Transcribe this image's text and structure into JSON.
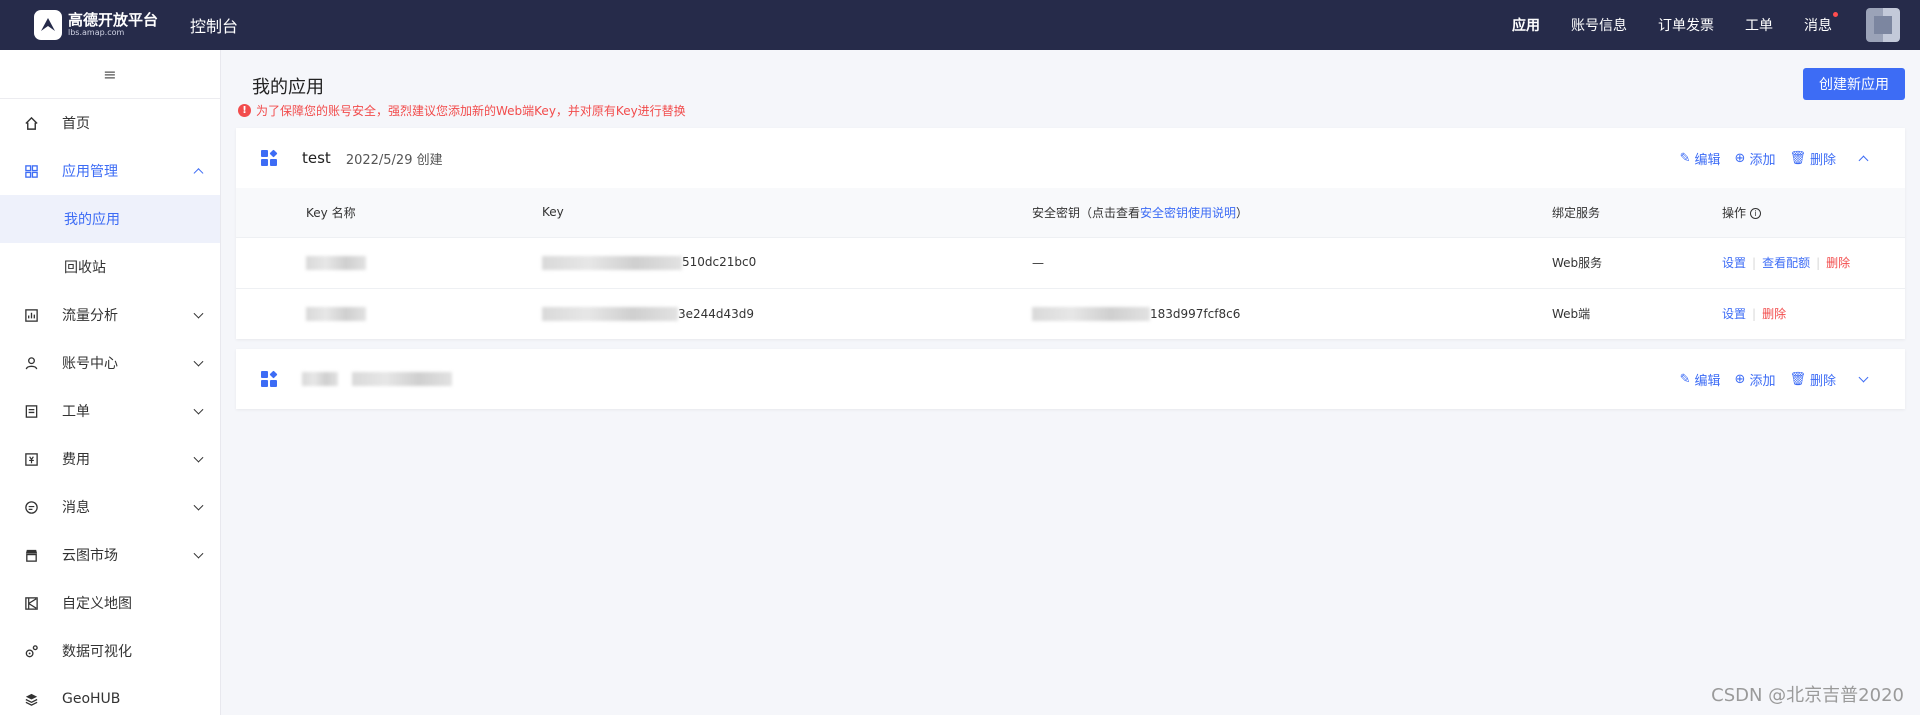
{
  "header": {
    "logo_cn": "高德开放平台",
    "logo_en": "lbs.amap.com",
    "console": "控制台",
    "nav": [
      "应用",
      "账号信息",
      "订单发票",
      "工单",
      "消息"
    ]
  },
  "sidebar": {
    "toggle": "≡",
    "items": [
      {
        "label": "首页"
      },
      {
        "label": "应用管理",
        "sub": [
          "我的应用",
          "回收站"
        ]
      },
      {
        "label": "流量分析"
      },
      {
        "label": "账号中心"
      },
      {
        "label": "工单"
      },
      {
        "label": "费用"
      },
      {
        "label": "消息"
      },
      {
        "label": "云图市场"
      },
      {
        "label": "自定义地图"
      },
      {
        "label": "数据可视化"
      },
      {
        "label": "GeoHUB"
      }
    ]
  },
  "main": {
    "title": "我的应用",
    "warning": "为了保障您的账号安全，强烈建议您添加新的Web端Key，并对原有Key进行替换",
    "create_button": "创建新应用",
    "actions": {
      "edit": "编辑",
      "add": "添加",
      "delete": "删除"
    },
    "apps": [
      {
        "name": "test",
        "date": "2022/5/29 创建",
        "columns": {
          "key_name": "Key 名称",
          "key": "Key",
          "secret_prefix": "安全密钥（点击查看",
          "secret_link": "安全密钥使用说明",
          "secret_suffix": "）",
          "service": "绑定服务",
          "ops": "操作"
        },
        "rows": [
          {
            "key_suffix": "510dc21bc0",
            "secret": "—",
            "service": "Web服务",
            "ops": [
              "设置",
              "查看配额",
              "删除"
            ]
          },
          {
            "key_suffix": "3e244d43d9",
            "secret_suffix": "183d997fcf8c6",
            "service": "Web端",
            "ops": [
              "设置",
              "删除"
            ]
          }
        ]
      }
    ]
  },
  "watermark": "CSDN @北京吉普2020",
  "colors": {
    "primary": "#3d6cf5",
    "danger": "#f24c4c",
    "topbar": "#262b4a"
  }
}
